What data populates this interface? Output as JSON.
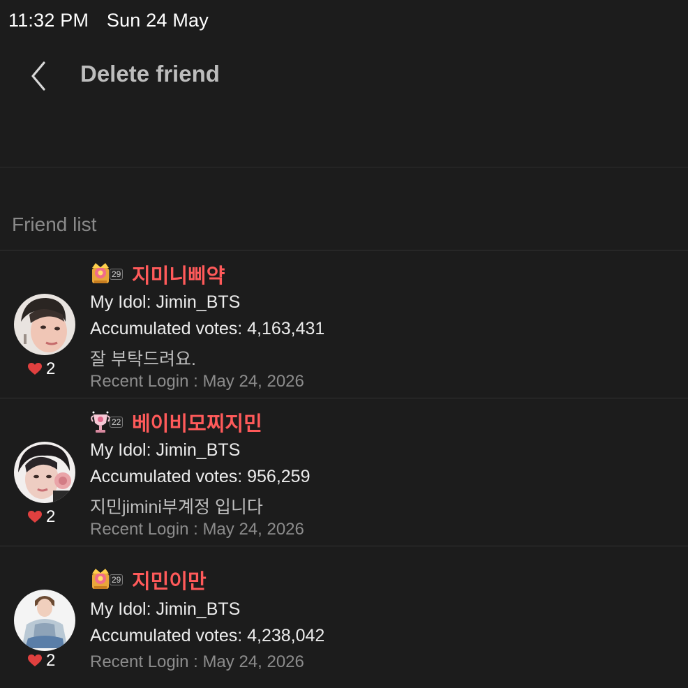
{
  "status_bar": {
    "time": "11:32 PM",
    "date": "Sun 24 May"
  },
  "header": {
    "title": "Delete friend",
    "back_icon": "chevron-left-icon"
  },
  "section": {
    "label": "Friend list"
  },
  "friends": [
    {
      "nickname": "지미니삐약",
      "badge_level": "29",
      "badge_icon": "crown-flower-badge-icon",
      "idol": "My Idol: Jimin_BTS",
      "votes": "Accumulated votes: 4,163,431",
      "bio": "잘 부탁드려요.",
      "recent_login": "Recent Login : May 24, 2026",
      "likes": "2"
    },
    {
      "nickname": "베이비모찌지민",
      "badge_level": "22",
      "badge_icon": "trophy-badge-icon",
      "idol": "My Idol: Jimin_BTS",
      "votes": "Accumulated votes: 956,259",
      "bio": "지민jimini부계정 입니다",
      "recent_login": "Recent Login : May 24, 2026",
      "likes": "2"
    },
    {
      "nickname": "지민이만",
      "badge_level": "29",
      "badge_icon": "crown-flower-badge-icon",
      "idol": "My Idol: Jimin_BTS",
      "votes": "Accumulated votes: 4,238,042",
      "recent_login": "Recent Login : May 24, 2026",
      "likes": "2"
    }
  ],
  "colors": {
    "background": "#1c1c1c",
    "nickname": "#ff5a5a",
    "heart": "#e0403f",
    "divider": "#333333"
  }
}
